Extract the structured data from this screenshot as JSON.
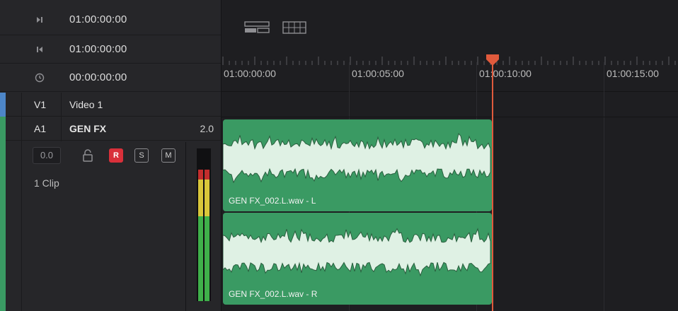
{
  "header": {
    "rows": [
      {
        "icon": "play-to-end-icon",
        "timecode": "01:00:00:00"
      },
      {
        "icon": "skip-to-start-icon",
        "timecode": "01:00:00:00"
      },
      {
        "icon": "clock-icon",
        "timecode": "00:00:00:00"
      }
    ]
  },
  "tracks": {
    "video": {
      "id": "V1",
      "name": "Video 1"
    },
    "audio": {
      "id": "A1",
      "name": "GEN FX",
      "channels": "2.0",
      "volume": "0.0",
      "clip_count": "1 Clip",
      "buttons": {
        "record": "R",
        "solo": "S",
        "mute": "M"
      }
    }
  },
  "ruler": {
    "labels": [
      "01:00:00:00",
      "01:00:05:00",
      "01:00:10:00",
      "01:00:15:00"
    ]
  },
  "clips": [
    {
      "label": "GEN FX_002.L.wav - L"
    },
    {
      "label": "GEN FX_002.L.wav - R"
    }
  ],
  "colors": {
    "clip": "#3a9a63",
    "playhead": "#e05a3c",
    "record": "#d9303a"
  }
}
